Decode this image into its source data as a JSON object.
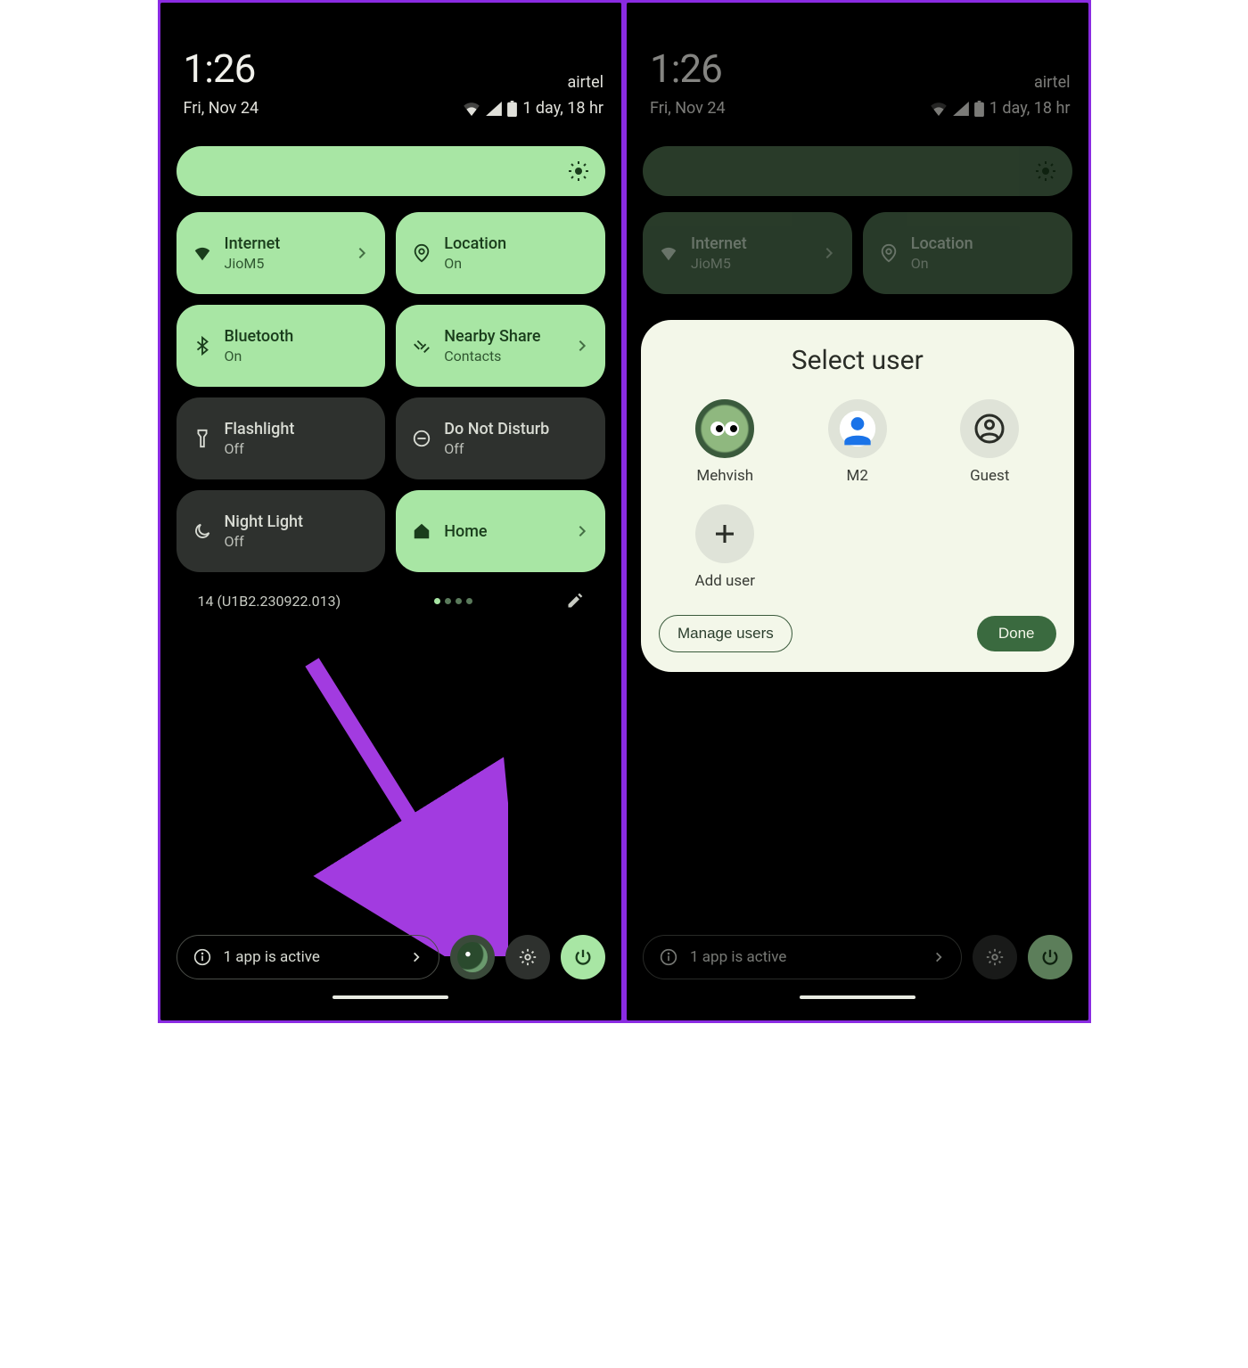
{
  "status": {
    "time": "1:26",
    "carrier": "airtel",
    "date": "Fri, Nov 24",
    "battery_text": "1 day, 18 hr"
  },
  "tiles": {
    "internet": {
      "title": "Internet",
      "sub": "JioM5"
    },
    "location": {
      "title": "Location",
      "sub": "On"
    },
    "bluetooth": {
      "title": "Bluetooth",
      "sub": "On"
    },
    "nearby": {
      "title": "Nearby Share",
      "sub": "Contacts"
    },
    "flashlight": {
      "title": "Flashlight",
      "sub": "Off"
    },
    "dnd": {
      "title": "Do Not Disturb",
      "sub": "Off"
    },
    "nightlight": {
      "title": "Night Light",
      "sub": "Off"
    },
    "home": {
      "title": "Home",
      "sub": ""
    }
  },
  "build": "14 (U1B2.230922.013)",
  "active_apps": "1 app is active",
  "dialog": {
    "title": "Select user",
    "users": {
      "u1": "Mehvish",
      "u2": "M2",
      "u3": "Guest",
      "add": "Add user"
    },
    "manage": "Manage users",
    "done": "Done"
  }
}
